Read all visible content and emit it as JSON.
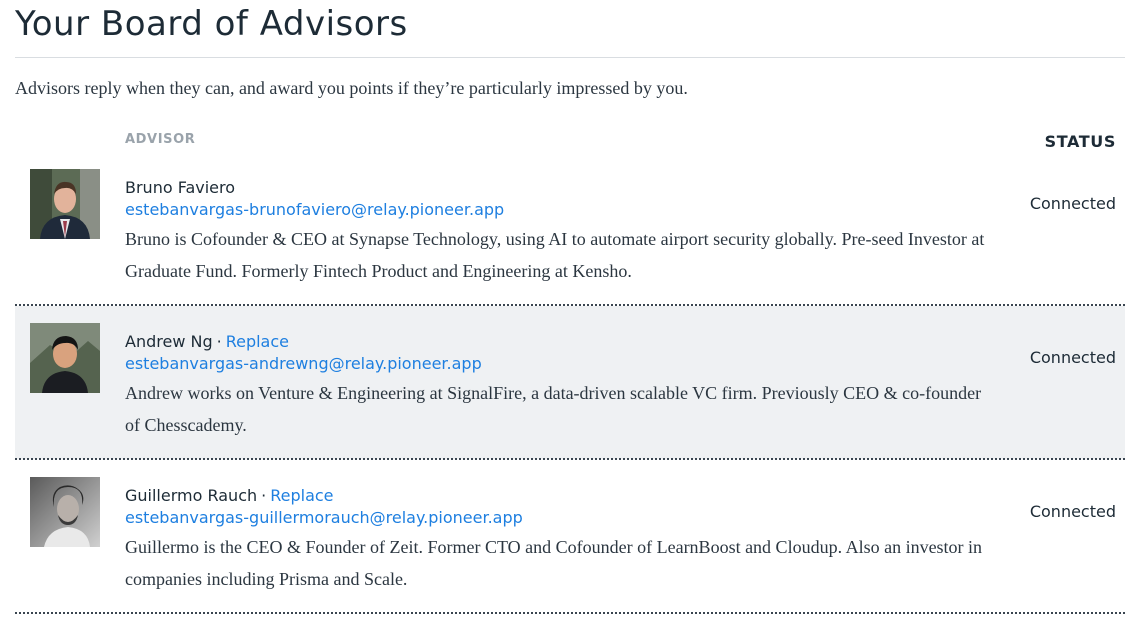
{
  "page": {
    "title": "Your Board of Advisors",
    "intro": "Advisors reply when they can, and award you points if they’re particularly impressed by you."
  },
  "table": {
    "headers": {
      "advisor": "ADVISOR",
      "status": "STATUS"
    },
    "rows": [
      {
        "name": "Bruno Faviero",
        "replace_label": "",
        "separator": "",
        "email": "estebanvargas-brunofaviero@relay.pioneer.app",
        "bio": "Bruno is Cofounder & CEO at Synapse Technology, using AI to automate airport security globally. Pre-seed Investor at Graduate Fund. Formerly Fintech Product and Engineering at Kensho.",
        "status": "Connected"
      },
      {
        "name": "Andrew Ng",
        "replace_label": "Replace",
        "separator": "·",
        "email": "estebanvargas-andrewng@relay.pioneer.app",
        "bio": "Andrew works on Venture & Engineering at SignalFire, a data-driven scalable VC firm. Previously CEO & co-founder of Chesscademy.",
        "status": "Connected"
      },
      {
        "name": "Guillermo Rauch",
        "replace_label": "Replace",
        "separator": "·",
        "email": "estebanvargas-guillermorauch@relay.pioneer.app",
        "bio": "Guillermo is the CEO & Founder of Zeit. Former CTO and Cofounder of LearnBoost and Cloudup. Also an investor in companies including Prisma and Scale.",
        "status": "Connected"
      }
    ]
  },
  "colors": {
    "link": "#1e7fe0",
    "alt_row_background": "#eff1f3",
    "header_text": "#9aa3ab"
  }
}
